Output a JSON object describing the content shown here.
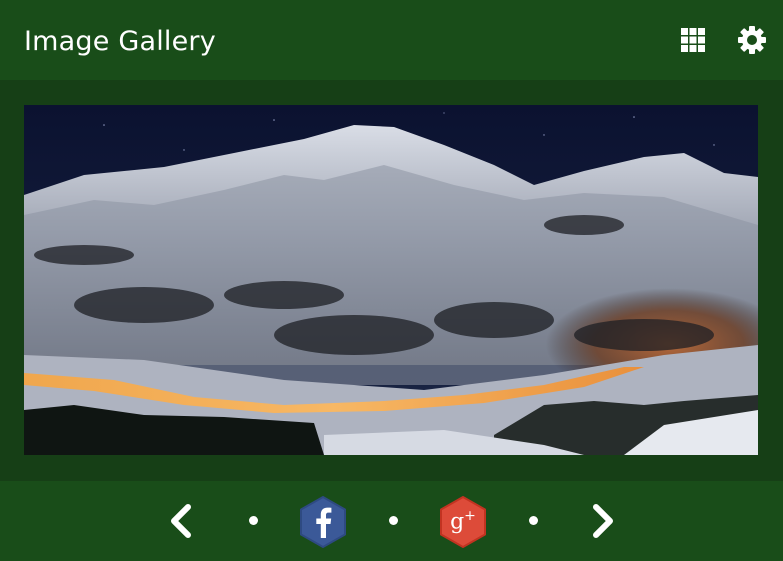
{
  "header": {
    "title": "Image Gallery",
    "grid_icon": "grid-icon",
    "settings_icon": "gear-icon"
  },
  "gallery": {
    "image_description_icon": "mountain-night-photo"
  },
  "footer": {
    "prev_icon": "chevron-left-icon",
    "next_icon": "chevron-right-icon",
    "facebook_icon": "facebook-icon",
    "google_plus": {
      "icon": "google-plus-icon",
      "glyph": "g",
      "plus": "+"
    }
  },
  "colors": {
    "header_bg": "#194d19",
    "content_bg": "#163f16",
    "facebook": "#3b5998",
    "google_plus": "#dd4b39",
    "text": "#ffffff"
  }
}
